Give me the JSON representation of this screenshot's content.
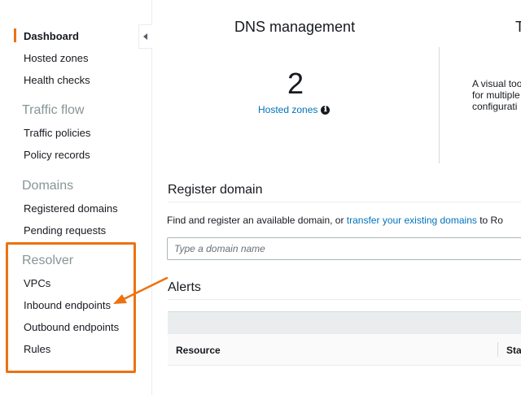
{
  "sidebar": {
    "items": [
      {
        "label": "Dashboard"
      },
      {
        "label": "Hosted zones"
      },
      {
        "label": "Health checks"
      },
      {
        "label": "Traffic policies"
      },
      {
        "label": "Policy records"
      },
      {
        "label": "Registered domains"
      },
      {
        "label": "Pending requests"
      },
      {
        "label": "VPCs"
      },
      {
        "label": "Inbound endpoints"
      },
      {
        "label": "Outbound endpoints"
      },
      {
        "label": "Rules"
      }
    ],
    "headings": {
      "traffic_flow": "Traffic flow",
      "domains": "Domains",
      "resolver": "Resolver"
    },
    "collapse_icon": "caret-left-icon"
  },
  "dns": {
    "title": "DNS management",
    "count": "2",
    "link": "Hosted zones",
    "info_icon": "ℹ"
  },
  "traffic": {
    "title_fragment": "T",
    "desc_lines": [
      "A visual too",
      "for multiple",
      "configurati"
    ]
  },
  "register": {
    "title": "Register domain",
    "desc_prefix": "Find and register an available domain, or ",
    "desc_link": "transfer your existing domains",
    "desc_suffix": " to Ro",
    "input_placeholder": "Type a domain name"
  },
  "alerts": {
    "title": "Alerts",
    "columns": [
      "Resource",
      "Statu"
    ]
  },
  "colors": {
    "accent": "#ec7211",
    "link": "#0073bb"
  }
}
